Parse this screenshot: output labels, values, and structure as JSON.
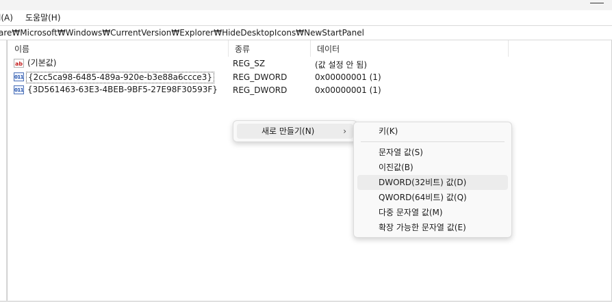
{
  "menubar": {
    "partial_item": "l(A)",
    "help": "도움말(H)"
  },
  "address": {
    "path": "are₩Microsoft₩Windows₩CurrentVersion₩Explorer₩HideDesktopIcons₩NewStartPanel"
  },
  "columns": {
    "name": "이름",
    "type": "종류",
    "data": "데이터"
  },
  "rows": [
    {
      "icon": "string-value-icon",
      "icon_glyph": "ab",
      "name": "(기본값)",
      "type": "REG_SZ",
      "data": "(값 설정 안 됨)"
    },
    {
      "icon": "binary-value-icon",
      "icon_glyph": "011",
      "name": "{2cc5ca98-6485-489a-920e-b3e88a6ccce3}",
      "type": "REG_DWORD",
      "data": "0x00000001 (1)"
    },
    {
      "icon": "binary-value-icon",
      "icon_glyph": "011",
      "name": "{3D561463-63E3-4BEB-9BF5-27E98F30593F}",
      "type": "REG_DWORD",
      "data": "0x00000001 (1)"
    }
  ],
  "context_menu": {
    "new_label": "새로 만들기(N)",
    "chevron": "›"
  },
  "submenu": {
    "key": "키(K)",
    "string_value": "문자열 값(S)",
    "binary_value": "이진값(B)",
    "dword_value": "DWORD(32비트) 값(D)",
    "qword_value": "QWORD(64비트) 값(Q)",
    "multi_string_value": "다중 문자열 값(M)",
    "expandable_string_value": "확장 가능한 문자열 값(E)"
  }
}
